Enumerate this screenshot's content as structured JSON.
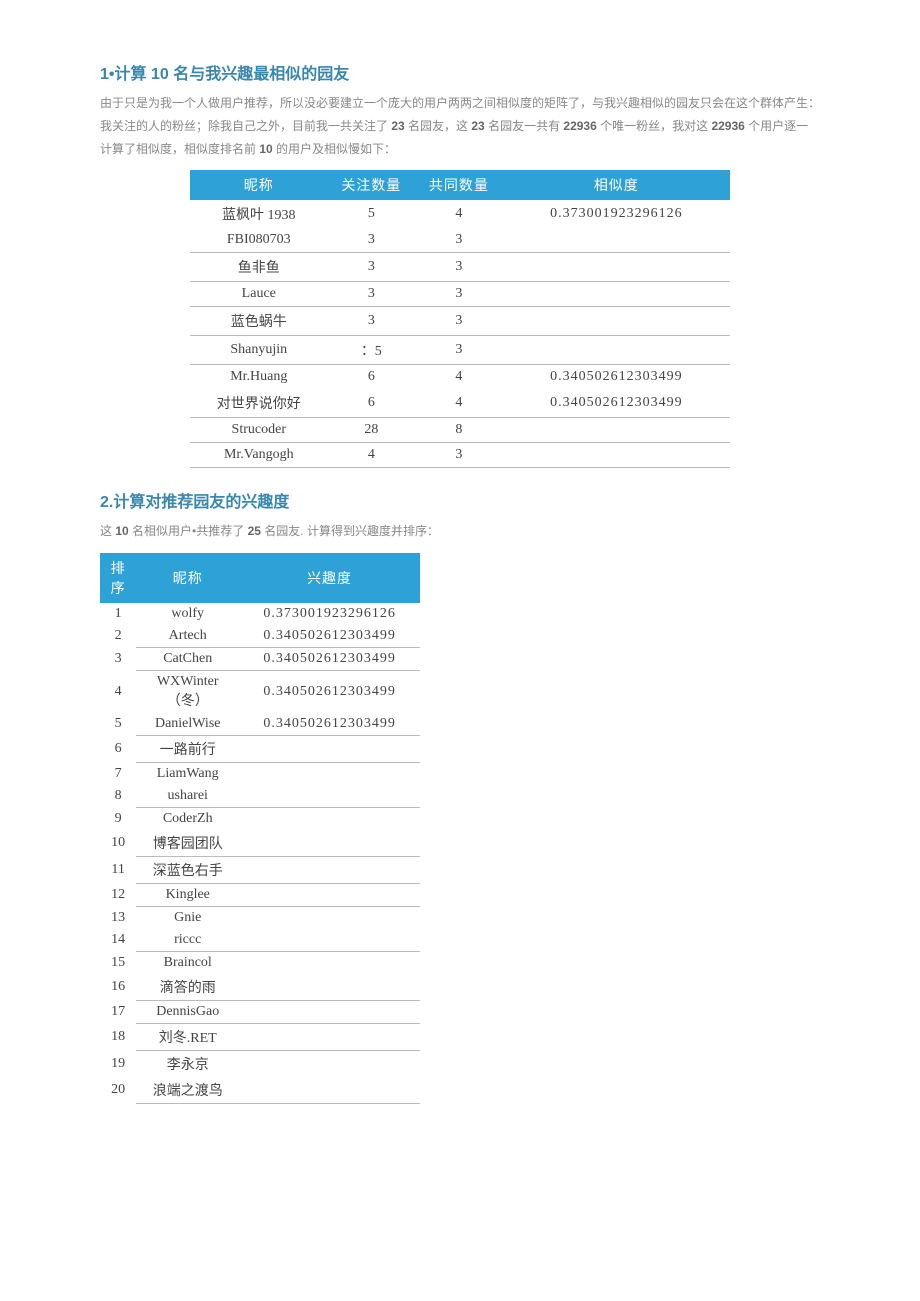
{
  "section1": {
    "title": "1•计算 10 名与我兴趣最相似的园友",
    "intro_a": "由于只是为我一个人做用户推荐，所以没必要建立一个庞大的用户两两之间相似度的矩阵了，与我兴趣相似的园友只会在这个群体产生：我关注的人的粉丝；除我自己之外，目前我一共关注了 ",
    "num_follow": "23",
    "intro_b": " 名园友，这 ",
    "num_follow2": "23",
    "intro_c": " 名园友一共有 ",
    "num_fans": "22936",
    "intro_d": " 个唯一粉丝，我对这 ",
    "num_fans2": "22936",
    "intro_e": " 个用户逐一计算了相似度，相似度排名前 ",
    "topn": "10",
    "intro_f": " 的用户及相似慢如下：",
    "headers": {
      "name": "昵称",
      "follow": "关注数量",
      "common": "共同数量",
      "sim": "相似度"
    },
    "rows": [
      {
        "name": "蓝枫叶 1938",
        "follow": "5",
        "common": "4",
        "sim": "0.373001923296126",
        "border": false
      },
      {
        "name": "FBI080703",
        "follow": "3",
        "common": "3",
        "sim": "",
        "border": true
      },
      {
        "name": "鱼非鱼",
        "follow": "3",
        "common": "3",
        "sim": "",
        "border": true
      },
      {
        "name": "Lauce",
        "follow": "3",
        "common": "3",
        "sim": "",
        "border": true
      },
      {
        "name": "蓝色蜗牛",
        "follow": "3",
        "common": "3",
        "sim": "",
        "border": true
      },
      {
        "name": "Shanyujin",
        "follow": "：5",
        "common": "3",
        "sim": "",
        "border": true
      },
      {
        "name": "Mr.Huang",
        "follow": "6",
        "common": "4",
        "sim": "0.340502612303499",
        "border": false
      },
      {
        "name": "对世界说你好",
        "follow": "6",
        "common": "4",
        "sim": "0.340502612303499",
        "border": true
      },
      {
        "name": "Strucoder",
        "follow": "28",
        "common": "8",
        "sim": "",
        "border": true
      },
      {
        "name": "Mr.Vangogh",
        "follow": "4",
        "common": "3",
        "sim": "",
        "border": true
      }
    ]
  },
  "section2": {
    "title": "2.计算对推荐园友的兴趣度",
    "intro_a": "这 ",
    "num_users": "10",
    "intro_b": " 名相似用户•共推荐了 ",
    "num_rec": "25",
    "intro_c": " 名园友. 计算得到兴趣度并排序：",
    "headers": {
      "rank": "排序",
      "name": "昵称",
      "interest": "兴趣度"
    },
    "rows": [
      {
        "rank": "1",
        "name": "wolfy",
        "interest": "0.373001923296126",
        "border": false
      },
      {
        "rank": "2",
        "name": "Artech",
        "interest": "0.340502612303499",
        "border": true
      },
      {
        "rank": "3",
        "name": "CatChen",
        "interest": "0.340502612303499",
        "border": true
      },
      {
        "rank": "4",
        "name": "WXWinter（冬）",
        "interest": "0.340502612303499",
        "border": false
      },
      {
        "rank": "5",
        "name": "DanielWise",
        "interest": "0.340502612303499",
        "border": true
      },
      {
        "rank": "6",
        "name": "一路前行",
        "interest": "",
        "border": true
      },
      {
        "rank": "7",
        "name": "LiamWang",
        "interest": "",
        "border": false
      },
      {
        "rank": "8",
        "name": "usharei",
        "interest": "",
        "border": true
      },
      {
        "rank": "9",
        "name": "CoderZh",
        "interest": "",
        "border": false
      },
      {
        "rank": "10",
        "name": "博客园团队",
        "interest": "",
        "border": true
      },
      {
        "rank": "11",
        "name": "深蓝色右手",
        "interest": "",
        "border": true
      },
      {
        "rank": "12",
        "name": "Kinglee",
        "interest": "",
        "border": true
      },
      {
        "rank": "13",
        "name": "Gnie",
        "interest": "",
        "border": false
      },
      {
        "rank": "14",
        "name": "riccc",
        "interest": "",
        "border": true
      },
      {
        "rank": "15",
        "name": "Braincol",
        "interest": "",
        "border": false
      },
      {
        "rank": "16",
        "name": "滴答的雨",
        "interest": "",
        "border": true
      },
      {
        "rank": "17",
        "name": "DennisGao",
        "interest": "",
        "border": true
      },
      {
        "rank": "18",
        "name": "刘冬.RET",
        "interest": "",
        "border": true
      },
      {
        "rank": "19",
        "name": "李永京",
        "interest": "",
        "border": false
      },
      {
        "rank": "20",
        "name": "浪端之渡鸟",
        "interest": "",
        "border": true
      }
    ]
  }
}
